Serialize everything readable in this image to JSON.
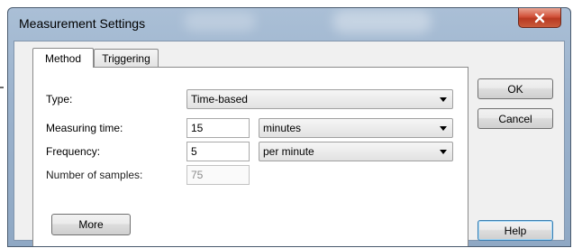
{
  "window": {
    "title": "Measurement Settings",
    "close_icon": "close-x-icon"
  },
  "tabs": [
    {
      "label": "Method",
      "selected": true
    },
    {
      "label": "Triggering",
      "selected": false
    }
  ],
  "form": {
    "type": {
      "label": "Type:",
      "value": "Time-based"
    },
    "measuring_time": {
      "label": "Measuring time:",
      "value": "15",
      "unit": "minutes"
    },
    "frequency": {
      "label": "Frequency:",
      "value": "5",
      "unit": "per minute"
    },
    "samples": {
      "label": "Number of samples:",
      "value": "75"
    }
  },
  "buttons": {
    "more": "More",
    "ok": "OK",
    "cancel": "Cancel",
    "help": "Help"
  },
  "colors": {
    "titlebar": "#9bb2cc",
    "close_button": "#c9462c",
    "focus_border": "#3c7fb1"
  }
}
